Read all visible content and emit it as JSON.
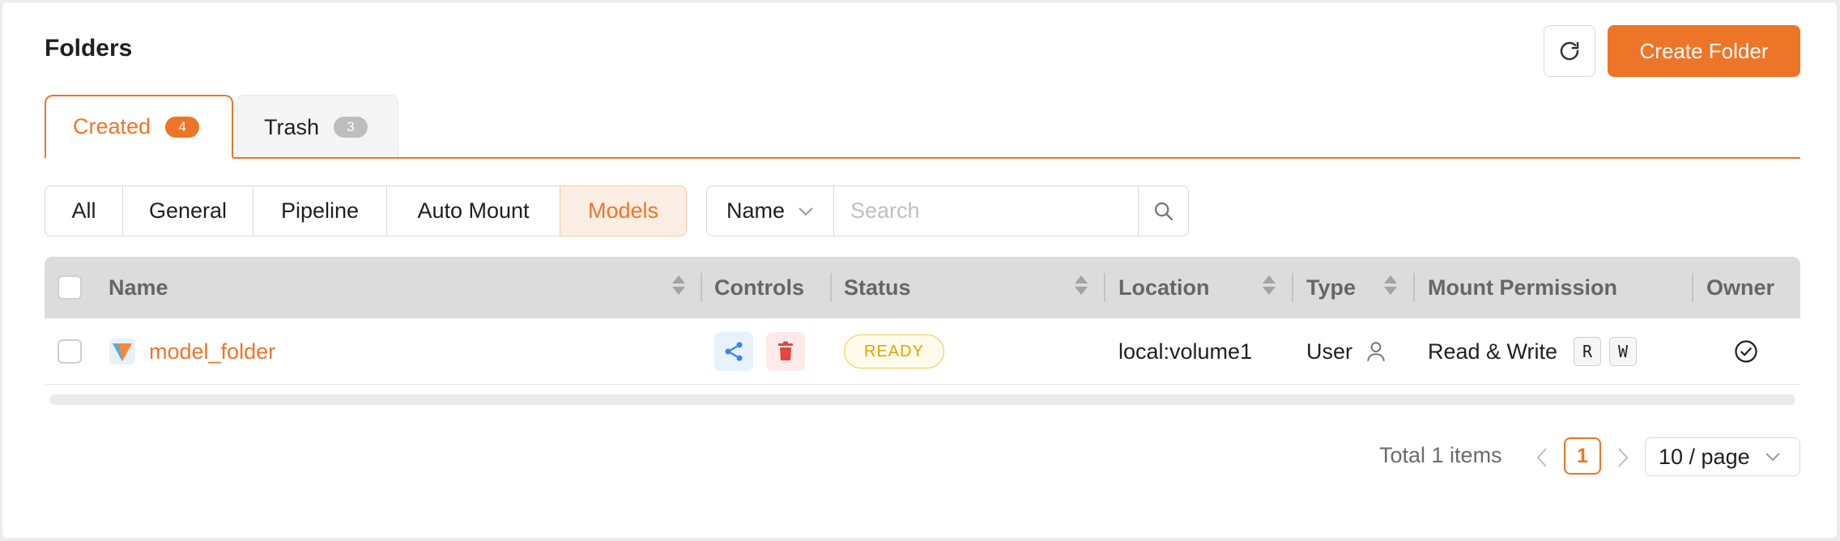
{
  "header": {
    "title": "Folders",
    "create_label": "Create Folder"
  },
  "tabs": [
    {
      "label": "Created",
      "count": "4",
      "active": true
    },
    {
      "label": "Trash",
      "count": "3",
      "active": false
    }
  ],
  "filters": {
    "items": [
      "All",
      "General",
      "Pipeline",
      "Auto Mount",
      "Models"
    ],
    "active": "Models"
  },
  "search": {
    "field": "Name",
    "placeholder": "Search",
    "value": ""
  },
  "table": {
    "columns": [
      "Name",
      "Controls",
      "Status",
      "Location",
      "Type",
      "Mount Permission",
      "Owner"
    ],
    "rows": [
      {
        "name": "model_folder",
        "status": "READY",
        "location": "local:volume1",
        "type": "User",
        "permission": "Read & Write",
        "perm_keys": [
          "R",
          "W"
        ]
      }
    ]
  },
  "pagination": {
    "total": "Total 1 items",
    "current": "1",
    "page_size": "10 / page"
  },
  "colors": {
    "accent": "#ed7528",
    "status_ready": "#e2a300",
    "share_icon": "#3b82f6",
    "delete_icon": "#e5453a"
  },
  "icons": {
    "refresh": "refresh-icon",
    "search": "search-icon",
    "share": "share-icon",
    "delete": "trash-icon",
    "user": "user-icon",
    "owner": "check-circle-icon",
    "folder_type": "model-folder-icon"
  }
}
